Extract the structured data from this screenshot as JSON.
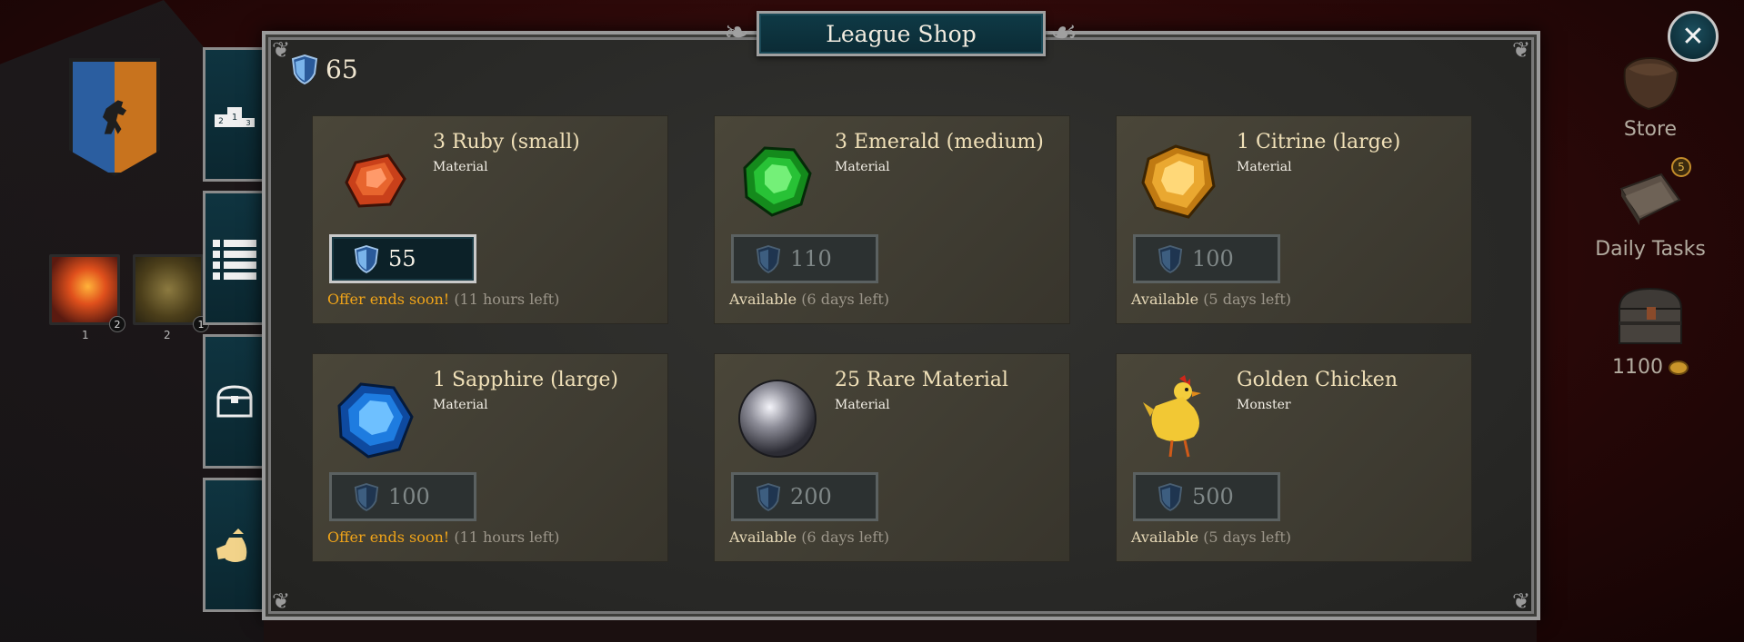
{
  "shop": {
    "title": "League Shop",
    "currency_amount": "65",
    "close_label": "✕"
  },
  "items": [
    {
      "name": "3 Ruby (small)",
      "type": "Material",
      "price": "55",
      "price_active": true,
      "status": "Offer ends soon!",
      "status_warn": true,
      "time_left": "(11 hours left)",
      "icon": "ruby-gem-icon",
      "color": "#d94a1e"
    },
    {
      "name": "3 Emerald (medium)",
      "type": "Material",
      "price": "110",
      "price_active": false,
      "status": "Available",
      "status_warn": false,
      "time_left": "(6 days left)",
      "icon": "emerald-gem-icon",
      "color": "#1faa2a"
    },
    {
      "name": "1 Citrine (large)",
      "type": "Material",
      "price": "100",
      "price_active": false,
      "status": "Available",
      "status_warn": false,
      "time_left": "(5 days left)",
      "icon": "citrine-gem-icon",
      "color": "#e0a02a"
    },
    {
      "name": "1 Sapphire (large)",
      "type": "Material",
      "price": "100",
      "price_active": false,
      "status": "Offer ends soon!",
      "status_warn": true,
      "time_left": "(11 hours left)",
      "icon": "sapphire-gem-icon",
      "color": "#1e78d9"
    },
    {
      "name": "25 Rare Material",
      "type": "Material",
      "price": "200",
      "price_active": false,
      "status": "Available",
      "status_warn": false,
      "time_left": "(6 days left)",
      "icon": "pearl-orb-icon",
      "color": "#8a8a94"
    },
    {
      "name": "Golden Chicken",
      "type": "Monster",
      "price": "500",
      "price_active": false,
      "status": "Available",
      "status_warn": false,
      "time_left": "(5 days left)",
      "icon": "golden-chicken-icon",
      "color": "#f0c83a"
    }
  ],
  "sidebar_tabs": [
    {
      "icon": "podium-icon"
    },
    {
      "icon": "list-icon"
    },
    {
      "icon": "chest-icon"
    },
    {
      "icon": "money-bag-icon"
    }
  ],
  "spells": [
    {
      "icon": "fireball-icon",
      "level": "1",
      "count": "2"
    },
    {
      "icon": "lightning-icon",
      "level": "2",
      "count": "1"
    }
  ],
  "right_menu": {
    "store_label": "Store",
    "daily_tasks_label": "Daily Tasks",
    "daily_tasks_badge": "5",
    "gold_amount": "1100"
  },
  "colors": {
    "accent_teal": "#0f3a46",
    "warning_orange": "#f0a419",
    "card_bg": "#433f34"
  }
}
